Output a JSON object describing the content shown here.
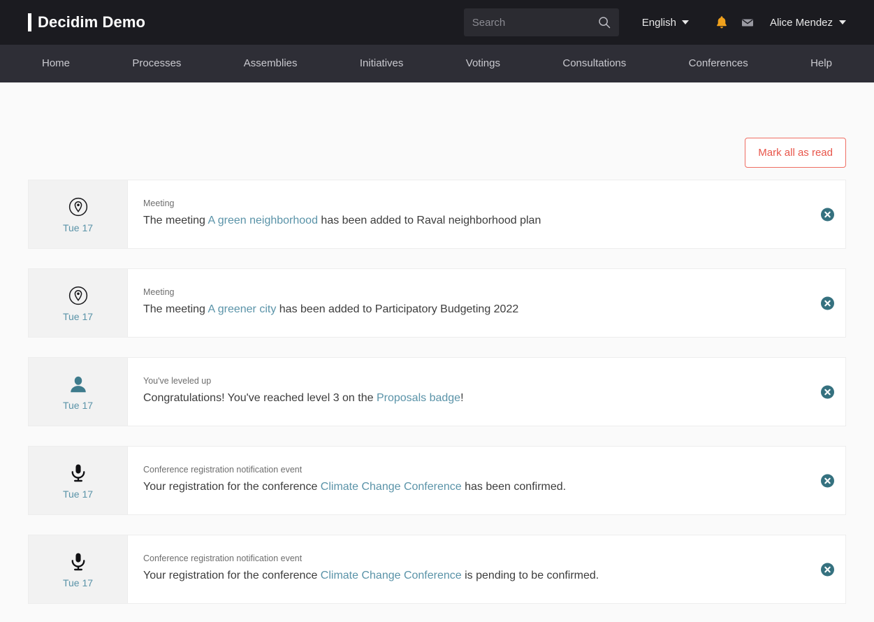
{
  "header": {
    "brand": "Decidim Demo",
    "search": {
      "placeholder": "Search",
      "value": "",
      "icon": "search-icon"
    },
    "language": {
      "label": "English",
      "icon": "chevron-down-icon"
    },
    "notifications_icon": "bell-icon",
    "messages_icon": "envelope-icon",
    "user": {
      "name": "Alice Mendez",
      "icon": "chevron-down-icon"
    },
    "colors": {
      "topbar_bg": "#1b1b20",
      "nav_bg": "#2e2e36",
      "bell": "#f0a11c"
    }
  },
  "nav": {
    "items": [
      {
        "label": "Home"
      },
      {
        "label": "Processes"
      },
      {
        "label": "Assemblies"
      },
      {
        "label": "Initiatives"
      },
      {
        "label": "Votings"
      },
      {
        "label": "Consultations"
      },
      {
        "label": "Conferences"
      },
      {
        "label": "Help"
      }
    ]
  },
  "toolbar": {
    "mark_all_read_label": "Mark all as read",
    "accent_color": "#e8554a"
  },
  "notifications": [
    {
      "day": "Tue 17",
      "icon": "map-pin-circle-icon",
      "kind": "Meeting",
      "text_before": "The meeting ",
      "link": "A green neighborhood",
      "text_after": " has been added to Raval neighborhood plan",
      "close_icon": "close-circle-icon"
    },
    {
      "day": "Tue 17",
      "icon": "map-pin-circle-icon",
      "kind": "Meeting",
      "text_before": "The meeting ",
      "link": "A greener city",
      "text_after": " has been added to Participatory Budgeting 2022",
      "close_icon": "close-circle-icon"
    },
    {
      "day": "Tue 17",
      "icon": "person-icon",
      "kind": "You've leveled up",
      "text_before": "Congratulations! You've reached level 3 on the ",
      "link": "Proposals badge",
      "text_after": "!",
      "close_icon": "close-circle-icon"
    },
    {
      "day": "Tue 17",
      "icon": "microphone-icon",
      "kind": "Conference registration notification event",
      "text_before": "Your registration for the conference ",
      "link": "Climate Change Conference",
      "text_after": " has been confirmed.",
      "close_icon": "close-circle-icon"
    },
    {
      "day": "Tue 17",
      "icon": "microphone-icon",
      "kind": "Conference registration notification event",
      "text_before": "Your registration for the conference ",
      "link": "Climate Change Conference",
      "text_after": " is pending to be confirmed.",
      "close_icon": "close-circle-icon"
    }
  ]
}
